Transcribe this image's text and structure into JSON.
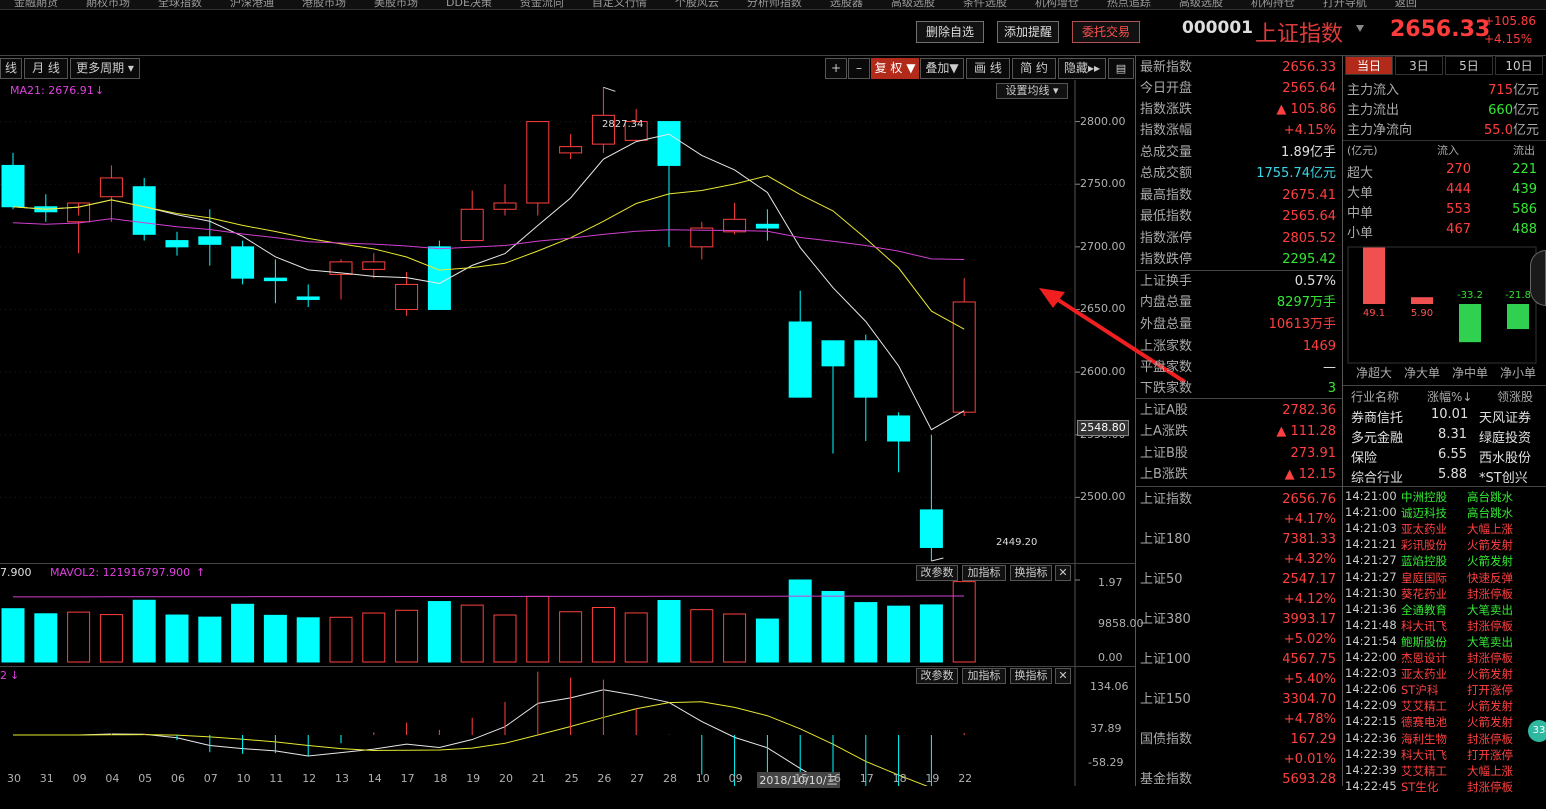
{
  "menu": [
    "金融期货",
    "期权市场",
    "全球指数",
    "沪深港通",
    "港股市场",
    "美股市场",
    "DDE决策",
    "资金流向",
    "自定义行情",
    "个股风云",
    "分析师指数",
    "选股器",
    "高级选股",
    "条件选股",
    "机构增仓",
    "热点追踪",
    "高级选股",
    "机构持仓",
    "打开导航",
    "返回"
  ],
  "header": {
    "btn_delete": "删除自选",
    "btn_alert": "添加提醒",
    "btn_trade": "委托交易",
    "code": "000001",
    "name": "上证指数",
    "price": "2656.33",
    "change": "+105.86",
    "change_pct": "+4.15%"
  },
  "toolbar": {
    "period_week": "线",
    "period_month": "月 线",
    "more_period": "更多周期",
    "plus": "+",
    "minus": "–",
    "fuquan": "复 权",
    "overlay": "叠加",
    "draw": "画 线",
    "simple": "简 约",
    "hide": "隐藏"
  },
  "ma": {
    "ma21": "MA21: 2676.91",
    "set_ma": "设置均线"
  },
  "chart_data": {
    "type": "candlestick",
    "x": [
      "30",
      "31",
      "09",
      "04",
      "05",
      "06",
      "07",
      "10",
      "11",
      "12",
      "13",
      "14",
      "17",
      "18",
      "19",
      "20",
      "21",
      "25",
      "26",
      "27",
      "28",
      "10",
      "09",
      "2018/10/10/三",
      "15",
      "16",
      "17",
      "18",
      "19",
      "22"
    ],
    "open": [
      2765,
      2732,
      2720,
      2740,
      2748,
      2705,
      2708,
      2700,
      2675,
      2660,
      2678,
      2682,
      2650,
      2700,
      2705,
      2730,
      2735,
      2775,
      2782,
      2785,
      2800,
      2700,
      2712,
      2718,
      2640,
      2625,
      2625,
      2565,
      2490,
      2568
    ],
    "high": [
      2775,
      2742,
      2725,
      2765,
      2755,
      2712,
      2730,
      2705,
      2690,
      2670,
      2690,
      2695,
      2680,
      2705,
      2745,
      2750,
      2800,
      2790,
      2827.34,
      2810,
      2800,
      2720,
      2735,
      2730,
      2665,
      2620,
      2630,
      2568,
      2550,
      2675
    ],
    "low": [
      2730,
      2720,
      2695,
      2720,
      2705,
      2693,
      2685,
      2670,
      2655,
      2652,
      2658,
      2675,
      2645,
      2650,
      2705,
      2725,
      2725,
      2770,
      2775,
      2785,
      2700,
      2690,
      2710,
      2705,
      2580,
      2535,
      2545,
      2520,
      2449.2,
      2565
    ],
    "close": [
      2732,
      2728,
      2735,
      2755,
      2710,
      2700,
      2702,
      2675,
      2673,
      2658,
      2688,
      2688,
      2670,
      2650,
      2730,
      2735,
      2800,
      2780,
      2805,
      2800,
      2765,
      2715,
      2722,
      2715,
      2580,
      2605,
      2580,
      2545,
      2460,
      2656
    ],
    "ylim": [
      2450,
      2830
    ],
    "y_ticks": [
      "2800.00",
      "2750.00",
      "2700.00",
      "2650.00",
      "2600.00",
      "2550.00",
      "2500.00"
    ],
    "current_price_label": "2548.80",
    "high_annotation": "2827.34",
    "low_annotation": "2449.20",
    "volume_label": "7.900",
    "mavol_label": "MAVOL2: 121916797.900",
    "volume_y_ticks": [
      "1.97",
      "9858.00",
      "0.00"
    ],
    "macd_y_ticks": [
      "134.06",
      "37.89",
      "-58.29"
    ]
  },
  "sub": {
    "gai": "改参数",
    "jia": "加指标",
    "huan": "换指标",
    "close": "✕",
    "macd_label": "2"
  },
  "quote": [
    {
      "k": "最新指数",
      "v": "2656.33",
      "c": "red"
    },
    {
      "k": "今日开盘",
      "v": "2565.64",
      "c": "red"
    },
    {
      "k": "指数涨跌",
      "v": "▲ 105.86",
      "c": "red"
    },
    {
      "k": "指数涨幅",
      "v": "+4.15%",
      "c": "red"
    },
    {
      "k": "总成交量",
      "v": "1.89亿手",
      "c": "wht"
    },
    {
      "k": "总成交额",
      "v": "1755.74亿元",
      "c": "cyn"
    },
    {
      "k": "最高指数",
      "v": "2675.41",
      "c": "red"
    },
    {
      "k": "最低指数",
      "v": "2565.64",
      "c": "red"
    },
    {
      "k": "指数涨停",
      "v": "2805.52",
      "c": "red"
    },
    {
      "k": "指数跌停",
      "v": "2295.42",
      "c": "grn"
    },
    {
      "k": "上证换手",
      "v": "0.57%",
      "c": "wht"
    },
    {
      "k": "内盘总量",
      "v": "8297万手",
      "c": "grn"
    },
    {
      "k": "外盘总量",
      "v": "10613万手",
      "c": "red"
    },
    {
      "k": "上涨家数",
      "v": "1469",
      "c": "red"
    },
    {
      "k": "平盘家数",
      "v": "—",
      "c": "wht"
    },
    {
      "k": "下跌家数",
      "v": "3",
      "c": "grn"
    },
    {
      "k": "上证A股",
      "v": "2782.36",
      "c": "red"
    },
    {
      "k": "上A涨跌",
      "v": "▲ 111.28",
      "c": "red"
    },
    {
      "k": "上证B股",
      "v": "273.91",
      "c": "red"
    },
    {
      "k": "上B涨跌",
      "v": "▲ 12.15",
      "c": "red"
    }
  ],
  "indices": [
    {
      "k": "上证指数",
      "v": "2656.76",
      "p": "+4.17%"
    },
    {
      "k": "上证180",
      "v": "7381.33",
      "p": "+4.32%"
    },
    {
      "k": "上证50",
      "v": "2547.17",
      "p": "+4.12%"
    },
    {
      "k": "上证380",
      "v": "3993.17",
      "p": "+5.02%"
    },
    {
      "k": "上证100",
      "v": "4567.75",
      "p": "+5.40%"
    },
    {
      "k": "上证150",
      "v": "3304.70",
      "p": "+4.78%"
    },
    {
      "k": "国债指数",
      "v": "167.29",
      "p": "+0.01%"
    },
    {
      "k": "基金指数",
      "v": "5693.28",
      "p": ""
    }
  ],
  "fund": {
    "tabs": [
      "当日",
      "3日",
      "5日",
      "10日"
    ],
    "flows": [
      {
        "k": "主力流入",
        "v": "715",
        "u": "亿元",
        "c": "red"
      },
      {
        "k": "主力流出",
        "v": "660",
        "u": "亿元",
        "c": "grn"
      },
      {
        "k": "主力净流向",
        "v": "55.0",
        "u": "亿元",
        "c": "red"
      }
    ],
    "unit": "(亿元)",
    "col_in": "流入",
    "col_out": "流出",
    "rows": [
      {
        "k": "超大",
        "a": "270",
        "b": "221"
      },
      {
        "k": "大单",
        "a": "444",
        "b": "439"
      },
      {
        "k": "中单",
        "a": "553",
        "b": "586"
      },
      {
        "k": "小单",
        "a": "467",
        "b": "488"
      }
    ],
    "net": [
      {
        "label": "净超大",
        "value": 49.1,
        "text": "49.1"
      },
      {
        "label": "净大单",
        "value": 5.9,
        "text": "5.90"
      },
      {
        "label": "净中单",
        "value": -33.2,
        "text": "-33.2"
      },
      {
        "label": "净小单",
        "value": -21.8,
        "text": "-21.8"
      }
    ],
    "badge": "33"
  },
  "sector": {
    "h1": "行业名称",
    "h2": "涨幅%↓",
    "h3": "领涨股",
    "rows": [
      {
        "k": "券商信托",
        "p": "10.01",
        "s": "天风证券"
      },
      {
        "k": "多元金融",
        "p": "8.31",
        "s": "绿庭投资"
      },
      {
        "k": "保险",
        "p": "6.55",
        "s": "西水股份"
      },
      {
        "k": "综合行业",
        "p": "5.88",
        "s": "*ST创兴"
      }
    ]
  },
  "news": [
    {
      "t": "14:21:00",
      "n": "中洲控股",
      "e": "高台跳水",
      "c": "grn"
    },
    {
      "t": "14:21:00",
      "n": "诚迈科技",
      "e": "高台跳水",
      "c": "grn"
    },
    {
      "t": "14:21:03",
      "n": "亚太药业",
      "e": "大幅上涨",
      "c": "red"
    },
    {
      "t": "14:21:21",
      "n": "彩讯股份",
      "e": "火箭发射",
      "c": "red"
    },
    {
      "t": "14:21:27",
      "n": "蓝焰控股",
      "e": "火箭发射",
      "c": "grn"
    },
    {
      "t": "14:21:27",
      "n": "皇庭国际",
      "e": "快速反弹",
      "c": "red"
    },
    {
      "t": "14:21:30",
      "n": "葵花药业",
      "e": "封涨停板",
      "c": "red"
    },
    {
      "t": "14:21:36",
      "n": "全通教育",
      "e": "大笔卖出",
      "c": "grn"
    },
    {
      "t": "14:21:48",
      "n": "科大讯飞",
      "e": "封涨停板",
      "c": "red"
    },
    {
      "t": "14:21:54",
      "n": "鲍斯股份",
      "e": "大笔卖出",
      "c": "grn"
    },
    {
      "t": "14:22:00",
      "n": "杰恩设计",
      "e": "封涨停板",
      "c": "red"
    },
    {
      "t": "14:22:03",
      "n": "亚太药业",
      "e": "火箭发射",
      "c": "red"
    },
    {
      "t": "14:22:06",
      "n": "ST沪科",
      "e": "打开涨停",
      "c": "red"
    },
    {
      "t": "14:22:09",
      "n": "艾艾精工",
      "e": "火箭发射",
      "c": "red"
    },
    {
      "t": "14:22:15",
      "n": "德赛电池",
      "e": "火箭发射",
      "c": "red"
    },
    {
      "t": "14:22:36",
      "n": "海利生物",
      "e": "封涨停板",
      "c": "red"
    },
    {
      "t": "14:22:39",
      "n": "科大讯飞",
      "e": "打开涨停",
      "c": "red"
    },
    {
      "t": "14:22:39",
      "n": "艾艾精工",
      "e": "大幅上涨",
      "c": "red"
    },
    {
      "t": "14:22:45",
      "n": "ST生化",
      "e": "封涨停板",
      "c": "red"
    }
  ]
}
